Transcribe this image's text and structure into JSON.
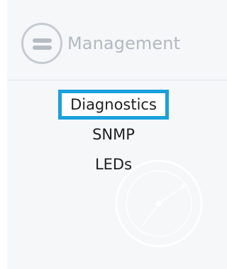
{
  "header": {
    "title": "Management",
    "icon": "equals-circle-icon"
  },
  "menu": {
    "items": [
      {
        "label": "Diagnostics",
        "selected": true
      },
      {
        "label": "SNMP",
        "selected": false
      },
      {
        "label": "LEDs",
        "selected": false
      }
    ]
  },
  "colors": {
    "selection_border": "#1aa0dc",
    "panel_background": "#f5f7f9",
    "header_text": "#b3b9c0",
    "item_text": "#1f1f1f"
  }
}
